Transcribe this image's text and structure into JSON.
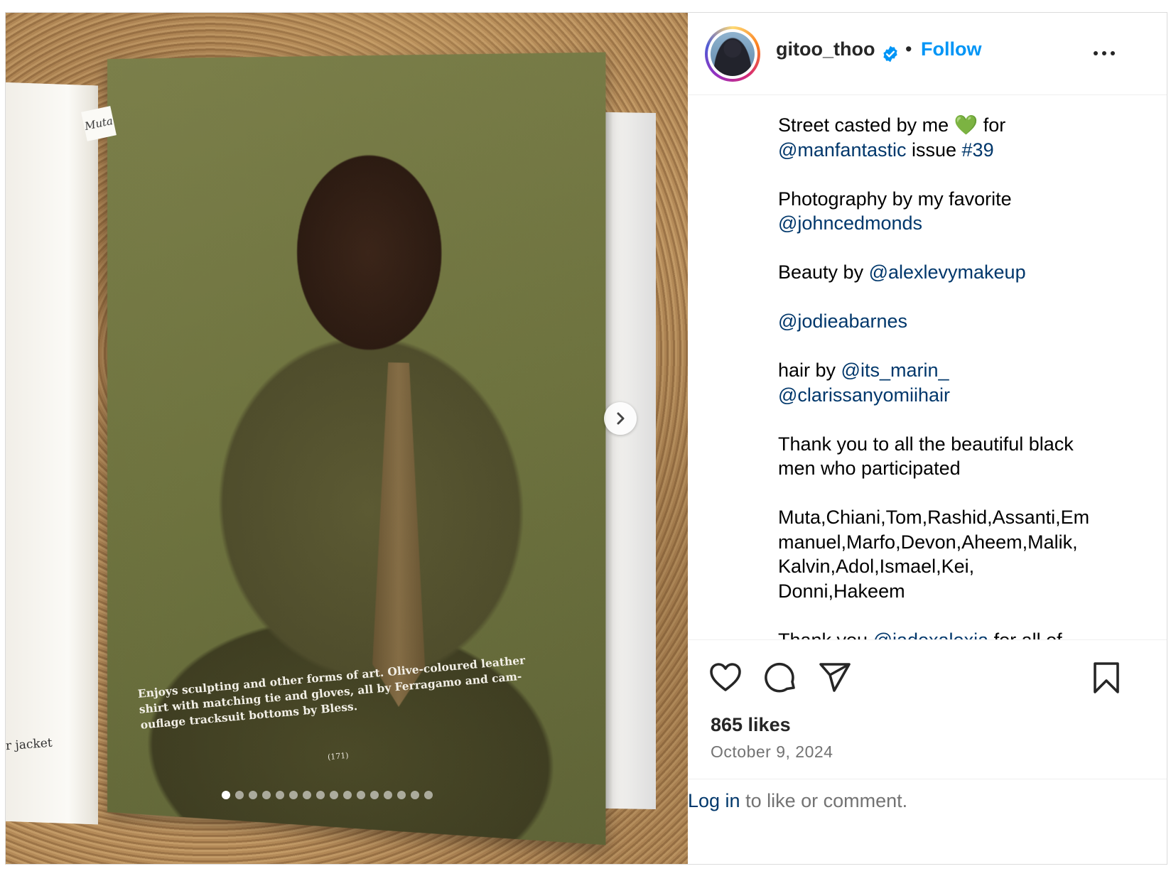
{
  "post": {
    "username": "gitoo_thoo",
    "separator": "•",
    "follow_label": "Follow",
    "icons": {
      "verified": "verified-badge-icon",
      "more": "more-options-icon",
      "like": "heart-icon",
      "comment": "comment-icon",
      "share": "paper-plane-icon",
      "save": "bookmark-icon",
      "next": "chevron-right-icon"
    },
    "colors": {
      "link": "#00376b",
      "follow": "#0095f6",
      "muted": "#737373"
    }
  },
  "media": {
    "magazine_tab": "Muta",
    "left_page_text": "r jacket",
    "caption_lines": [
      "Enjoys sculpting and other forms of art. Olive-coloured leather",
      "shirt with matching tie and gloves, all by Ferragamo and cam-",
      "ouflage tracksuit bottoms by Bless."
    ],
    "page_number": "(171)",
    "carousel_count": 16,
    "carousel_active": 0
  },
  "caption": {
    "l1a": "Street casted by me ",
    "emoji": "💚",
    "l1b": " for",
    "l2a": "@manfantastic",
    "l2b": " issue ",
    "l2c": "#39",
    "l3": "Photography by my favorite",
    "l4": "@johncedmonds",
    "l5a": "Beauty by ",
    "l5b": "@alexlevymakeup",
    "l6": "@jodieabarnes",
    "l7a": "hair by ",
    "l7b": "@its_marin_",
    "l8": "@clarissanyomiihair",
    "l9": "Thank you to all the beautiful black",
    "l10": "men who participated",
    "l11": "Muta,Chiani,Tom,Rashid,Assanti,Em",
    "l12": "manuel,Marfo,Devon,Aheem,Malik,",
    "l13": "Kalvin,Adol,Ismael,Kei,",
    "l14": "Donni,Hakeem",
    "l15a": "Thank you ",
    "l15b": "@jadexalexia",
    "l15c": " for all of"
  },
  "footer": {
    "likes": "865 likes",
    "date": "October 9, 2024",
    "login_link": "Log in",
    "login_rest": " to like or comment."
  }
}
